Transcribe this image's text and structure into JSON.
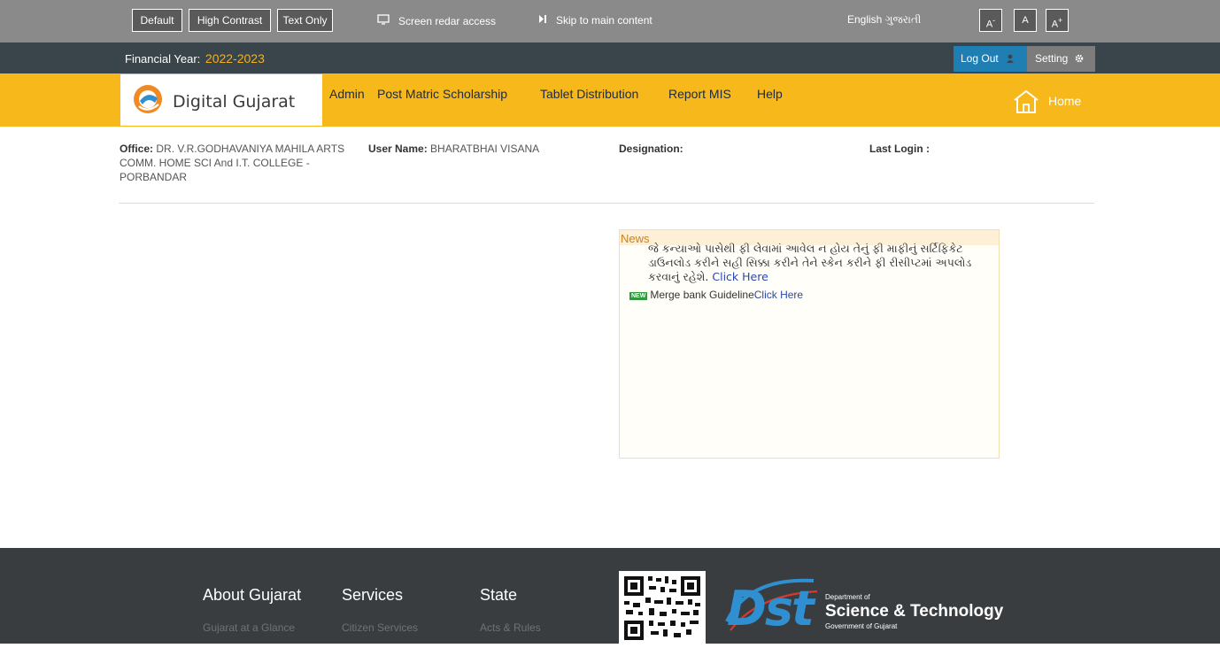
{
  "accessibility_bar": {
    "buttons": [
      "Default",
      "High Contrast",
      "Text Only"
    ],
    "screen_reader": "Screen redar access",
    "skip_link": "Skip to main content",
    "languages": "English ગુજરાતી",
    "font_sizes": [
      "A",
      "A",
      "A"
    ]
  },
  "financial": {
    "label": "Financial Year:",
    "year": "2022-2023"
  },
  "user_menu": {
    "logout": "Log Out",
    "setting": "Setting"
  },
  "brand": {
    "name": "Digital Gujarat"
  },
  "nav": {
    "items": [
      "Admin",
      "Post Matric Scholarship",
      "Tablet Distribution",
      "Report MIS",
      "Help"
    ],
    "home": "Home"
  },
  "user_info": {
    "office_label": "Office:",
    "office_value": "DR. V.R.GODHAVANIYA MAHILA ARTS COMM. HOME SCI And I.T. COLLEGE - PORBANDAR",
    "username_label": "User Name:",
    "username_value": "BHARATBHAI VISANA",
    "designation_label": "Designation:",
    "designation_value": "",
    "last_login_label": "Last Login :",
    "last_login_value": ""
  },
  "news": {
    "title": "News",
    "item1_text": "જે કન્યાઓ પાસેથી ફી લેવામાં આવેલ ન હોય તેનું ફી માફીનું સર્ટિફિકેટ ડાઉનલોડ કરીને સહી સિક્કા કરીને તેને સ્કેન કરીને ફી રીસીપ્ટમાં અપલોડ કરવાનું રહેશે.",
    "item1_link": "Click Here",
    "badge": "NEW",
    "item2_text": "Merge bank Guideline",
    "item2_link": "Click Here"
  },
  "footer": {
    "about_heading": "About Gujarat",
    "about_link": "Gujarat at a Glance",
    "services_heading": "Services",
    "services_link": "Citizen Services",
    "state_heading": "State",
    "state_link": "Acts & Rules",
    "dst_dept": "Department of",
    "dst_name": "Science & Technology",
    "dst_gov": "Government of Gujarat",
    "dst_logo": "Dst"
  },
  "colors": {
    "accent_yellow": "#f6b81a",
    "dark_bar": "#3a444b",
    "logout_blue": "#1f7fb3",
    "footer": "#3a3d40"
  }
}
